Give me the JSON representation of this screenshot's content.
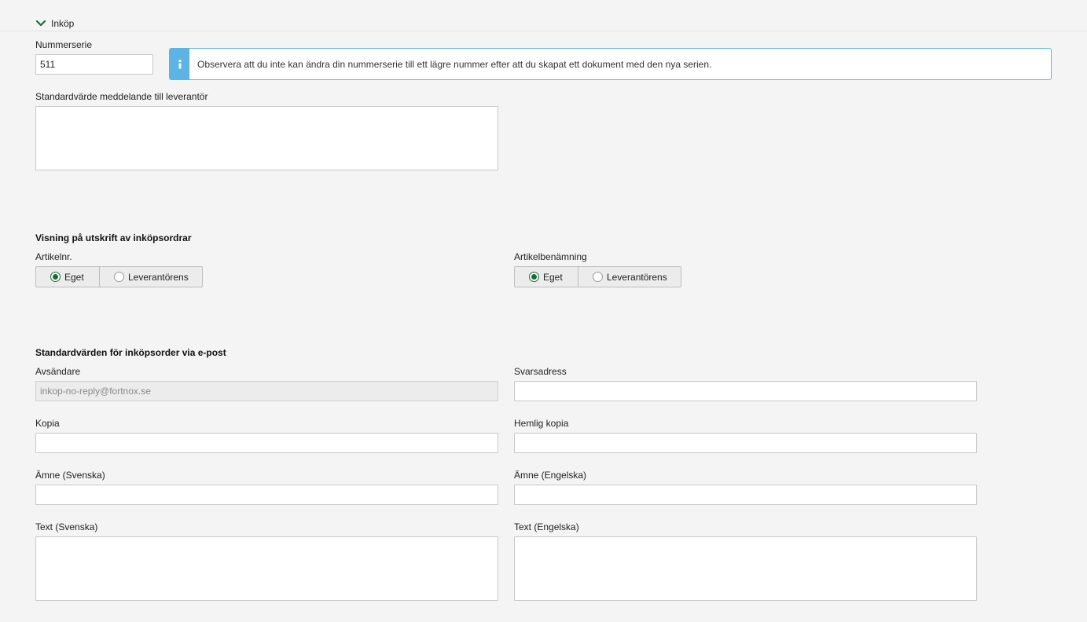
{
  "section": {
    "title": "Inköp",
    "icon": "chevron-down-icon"
  },
  "numberseries": {
    "label": "Nummerserie",
    "value": "511"
  },
  "info": {
    "icon": "info-icon",
    "text": "Observera att du inte kan ändra din nummerserie till ett lägre nummer efter att du skapat ett dokument med den nya serien."
  },
  "supplier_message": {
    "label": "Standardvärde meddelande till leverantör",
    "value": ""
  },
  "print_display": {
    "title": "Visning på utskrift av inköpsordrar",
    "article_number": {
      "label": "Artikelnr.",
      "options": [
        {
          "label": "Eget",
          "checked": true
        },
        {
          "label": "Leverantörens",
          "checked": false
        }
      ]
    },
    "article_name": {
      "label": "Artikelbenämning",
      "options": [
        {
          "label": "Eget",
          "checked": true
        },
        {
          "label": "Leverantörens",
          "checked": false
        }
      ]
    }
  },
  "email_defaults": {
    "title": "Standardvärden för inköpsorder via e-post",
    "sender": {
      "label": "Avsändare",
      "value": "inkop-no-reply@fortnox.se"
    },
    "reply_address": {
      "label": "Svarsadress",
      "value": ""
    },
    "cc": {
      "label": "Kopia",
      "value": ""
    },
    "bcc": {
      "label": "Hemlig kopia",
      "value": ""
    },
    "subject_sv": {
      "label": "Ämne (Svenska)",
      "value": ""
    },
    "subject_en": {
      "label": "Ämne (Engelska)",
      "value": ""
    },
    "text_sv": {
      "label": "Text (Svenska)",
      "value": ""
    },
    "text_en": {
      "label": "Text (Engelska)",
      "value": ""
    }
  },
  "colors": {
    "accent_green": "#1c6b3a",
    "info_blue": "#5bb4e4",
    "background": "#f4f4f4"
  }
}
